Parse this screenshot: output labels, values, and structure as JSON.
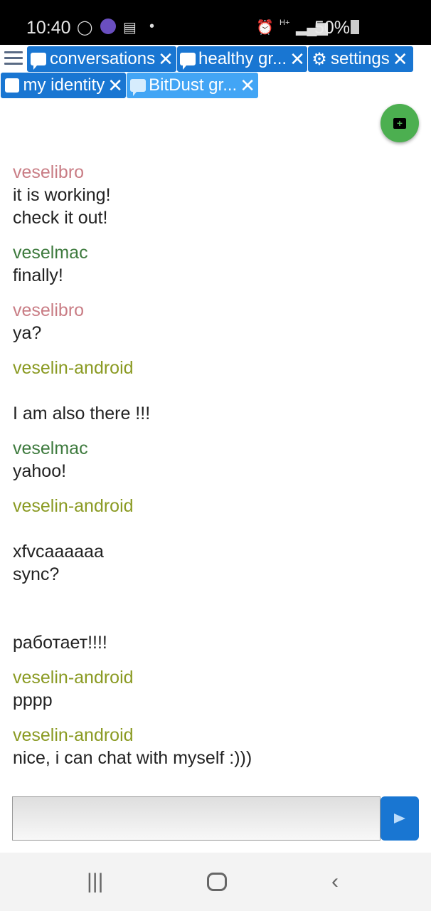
{
  "status_bar": {
    "time": "10:40",
    "battery": "50%",
    "network": "H+",
    "icons": [
      "whatsapp-icon",
      "app-icon",
      "calendar-icon",
      "dot-icon",
      "alarm-icon",
      "signal-icon",
      "battery-icon"
    ]
  },
  "tabs": [
    {
      "label": "conversations",
      "icon": "conversations-icon",
      "active": false
    },
    {
      "label": "healthy gr...",
      "icon": "chat-bubble-icon",
      "active": false
    },
    {
      "label": "settings",
      "icon": "gear-icon",
      "active": false
    },
    {
      "label": "my identity",
      "icon": "identity-icon",
      "active": false
    },
    {
      "label": "BitDust gr...",
      "icon": "chat-bubble-icon",
      "active": true
    }
  ],
  "close_glyph": "✕",
  "colors": {
    "tab": "#1976d2",
    "tab_active": "#42a5f5",
    "fab": "#4caf50",
    "veselibro": "#c97d85",
    "veselmac": "#3d7a3d",
    "veselin-android": "#8a9a22"
  },
  "messages": [
    {
      "sender": "veselibro",
      "lines": [
        "it is working!",
        "check it out!"
      ]
    },
    {
      "sender": "veselmac",
      "lines": [
        "finally!"
      ]
    },
    {
      "sender": "veselibro",
      "lines": [
        "ya?"
      ]
    },
    {
      "sender": "veselin-android",
      "lines": [
        "",
        "I am also there !!!"
      ]
    },
    {
      "sender": "veselmac",
      "lines": [
        "yahoo!"
      ]
    },
    {
      "sender": "veselin-android",
      "lines": [
        "",
        "xfvcaaaaaa",
        "sync?",
        "",
        "",
        "работает!!!!"
      ]
    },
    {
      "sender": "veselin-android",
      "lines": [
        "pppp"
      ]
    },
    {
      "sender": "veselin-android",
      "lines": [
        "nice, i can chat with myself :)))"
      ]
    }
  ],
  "composer": {
    "value": "",
    "placeholder": ""
  }
}
